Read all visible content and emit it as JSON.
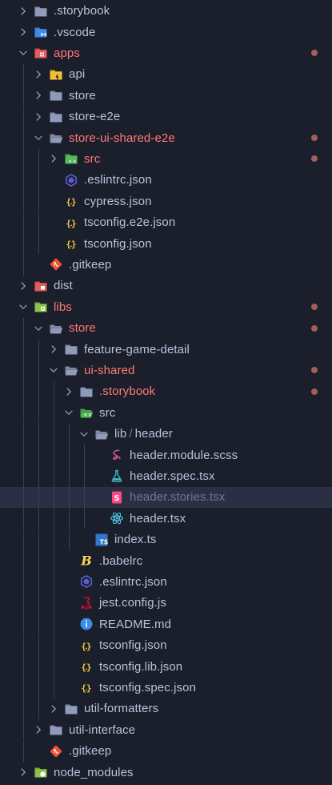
{
  "explorer": {
    "items": [
      {
        "label": "",
        "label_a": ".storybook",
        "depth": 0,
        "icon": "folder-storybook-icon",
        "kind": "folder",
        "expanded": false,
        "modified": false
      },
      {
        "label_a": ".vscode",
        "depth": 0,
        "icon": "folder-vscode-icon",
        "kind": "folder",
        "expanded": false,
        "modified": false
      },
      {
        "label_a": "apps",
        "depth": 0,
        "icon": "folder-apps-icon",
        "kind": "folder",
        "expanded": true,
        "modified": true
      },
      {
        "label_a": "api",
        "depth": 1,
        "icon": "folder-api-icon",
        "kind": "folder",
        "expanded": false,
        "modified": false
      },
      {
        "label_a": "store",
        "depth": 1,
        "icon": "folder-icon",
        "kind": "folder",
        "expanded": false,
        "modified": false
      },
      {
        "label_a": "store-e2e",
        "depth": 1,
        "icon": "folder-icon",
        "kind": "folder",
        "expanded": false,
        "modified": false
      },
      {
        "label_a": "store-ui-shared-e2e",
        "depth": 1,
        "icon": "folder-open-icon",
        "kind": "folder",
        "expanded": true,
        "modified": true
      },
      {
        "label_a": "src",
        "depth": 2,
        "icon": "folder-src-icon",
        "kind": "folder",
        "expanded": false,
        "modified": true
      },
      {
        "label_a": ".eslintrc.json",
        "depth": 2,
        "icon": "eslint-icon",
        "kind": "file",
        "modified": false
      },
      {
        "label_a": "cypress.json",
        "depth": 2,
        "icon": "json-icon",
        "kind": "file",
        "modified": false
      },
      {
        "label_a": "tsconfig.e2e.json",
        "depth": 2,
        "icon": "json-icon",
        "kind": "file",
        "modified": false
      },
      {
        "label_a": "tsconfig.json",
        "depth": 2,
        "icon": "json-icon",
        "kind": "file",
        "modified": false
      },
      {
        "label_a": ".gitkeep",
        "depth": 1,
        "icon": "git-icon",
        "kind": "file",
        "modified": false
      },
      {
        "label_a": "dist",
        "depth": 0,
        "icon": "folder-dist-icon",
        "kind": "folder",
        "expanded": false,
        "modified": false
      },
      {
        "label_a": "libs",
        "depth": 0,
        "icon": "folder-libs-icon",
        "kind": "folder",
        "expanded": true,
        "modified": true
      },
      {
        "label_a": "store",
        "depth": 1,
        "icon": "folder-open-icon",
        "kind": "folder",
        "expanded": true,
        "modified": true
      },
      {
        "label_a": "feature-game-detail",
        "depth": 2,
        "icon": "folder-icon",
        "kind": "folder",
        "expanded": false,
        "modified": false
      },
      {
        "label_a": "ui-shared",
        "depth": 2,
        "icon": "folder-open-icon",
        "kind": "folder",
        "expanded": true,
        "modified": true
      },
      {
        "label_a": ".storybook",
        "depth": 3,
        "icon": "folder-icon",
        "kind": "folder",
        "expanded": false,
        "modified": true
      },
      {
        "label_a": "src",
        "depth": 3,
        "icon": "folder-src-open-icon",
        "kind": "folder",
        "expanded": true,
        "modified": false
      },
      {
        "label_a": "lib",
        "label_b": "header",
        "sep": "/",
        "depth": 4,
        "icon": "folder-open-icon",
        "kind": "folder",
        "expanded": true,
        "modified": false
      },
      {
        "label_a": "header.module.scss",
        "depth": 5,
        "icon": "sass-icon",
        "kind": "file",
        "modified": false
      },
      {
        "label_a": "header.spec.tsx",
        "depth": 5,
        "icon": "test-flask-icon",
        "kind": "file",
        "modified": false
      },
      {
        "label_a": "header.stories.tsx",
        "depth": 5,
        "icon": "storybook-icon",
        "kind": "file",
        "modified": false,
        "selected": true
      },
      {
        "label_a": "header.tsx",
        "depth": 5,
        "icon": "react-icon",
        "kind": "file",
        "modified": false
      },
      {
        "label_a": "index.ts",
        "depth": 4,
        "icon": "typescript-icon",
        "kind": "file",
        "modified": false
      },
      {
        "label_a": ".babelrc",
        "depth": 3,
        "icon": "babel-icon",
        "kind": "file",
        "modified": false
      },
      {
        "label_a": ".eslintrc.json",
        "depth": 3,
        "icon": "eslint-icon",
        "kind": "file",
        "modified": false
      },
      {
        "label_a": "jest.config.js",
        "depth": 3,
        "icon": "jest-icon",
        "kind": "file",
        "modified": false
      },
      {
        "label_a": "README.md",
        "depth": 3,
        "icon": "info-icon",
        "kind": "file",
        "modified": false
      },
      {
        "label_a": "tsconfig.json",
        "depth": 3,
        "icon": "json-icon",
        "kind": "file",
        "modified": false
      },
      {
        "label_a": "tsconfig.lib.json",
        "depth": 3,
        "icon": "json-icon",
        "kind": "file",
        "modified": false
      },
      {
        "label_a": "tsconfig.spec.json",
        "depth": 3,
        "icon": "json-icon",
        "kind": "file",
        "modified": false
      },
      {
        "label_a": "util-formatters",
        "depth": 2,
        "icon": "folder-icon",
        "kind": "folder",
        "expanded": false,
        "modified": false
      },
      {
        "label_a": "util-interface",
        "depth": 1,
        "icon": "folder-icon",
        "kind": "folder",
        "expanded": false,
        "modified": false
      },
      {
        "label_a": ".gitkeep",
        "depth": 1,
        "icon": "git-icon",
        "kind": "file",
        "modified": false
      },
      {
        "label_a": "node_modules",
        "depth": 0,
        "icon": "folder-node-icon",
        "kind": "folder",
        "expanded": false,
        "modified": false
      }
    ]
  },
  "colors": {
    "background": "#1b1e2b",
    "text": "#b9c2dc",
    "modified_text": "#ff7a73",
    "modified_dot": "#a35e5c",
    "selected_row": "#2a2f43",
    "guide": "#3a3f55"
  }
}
